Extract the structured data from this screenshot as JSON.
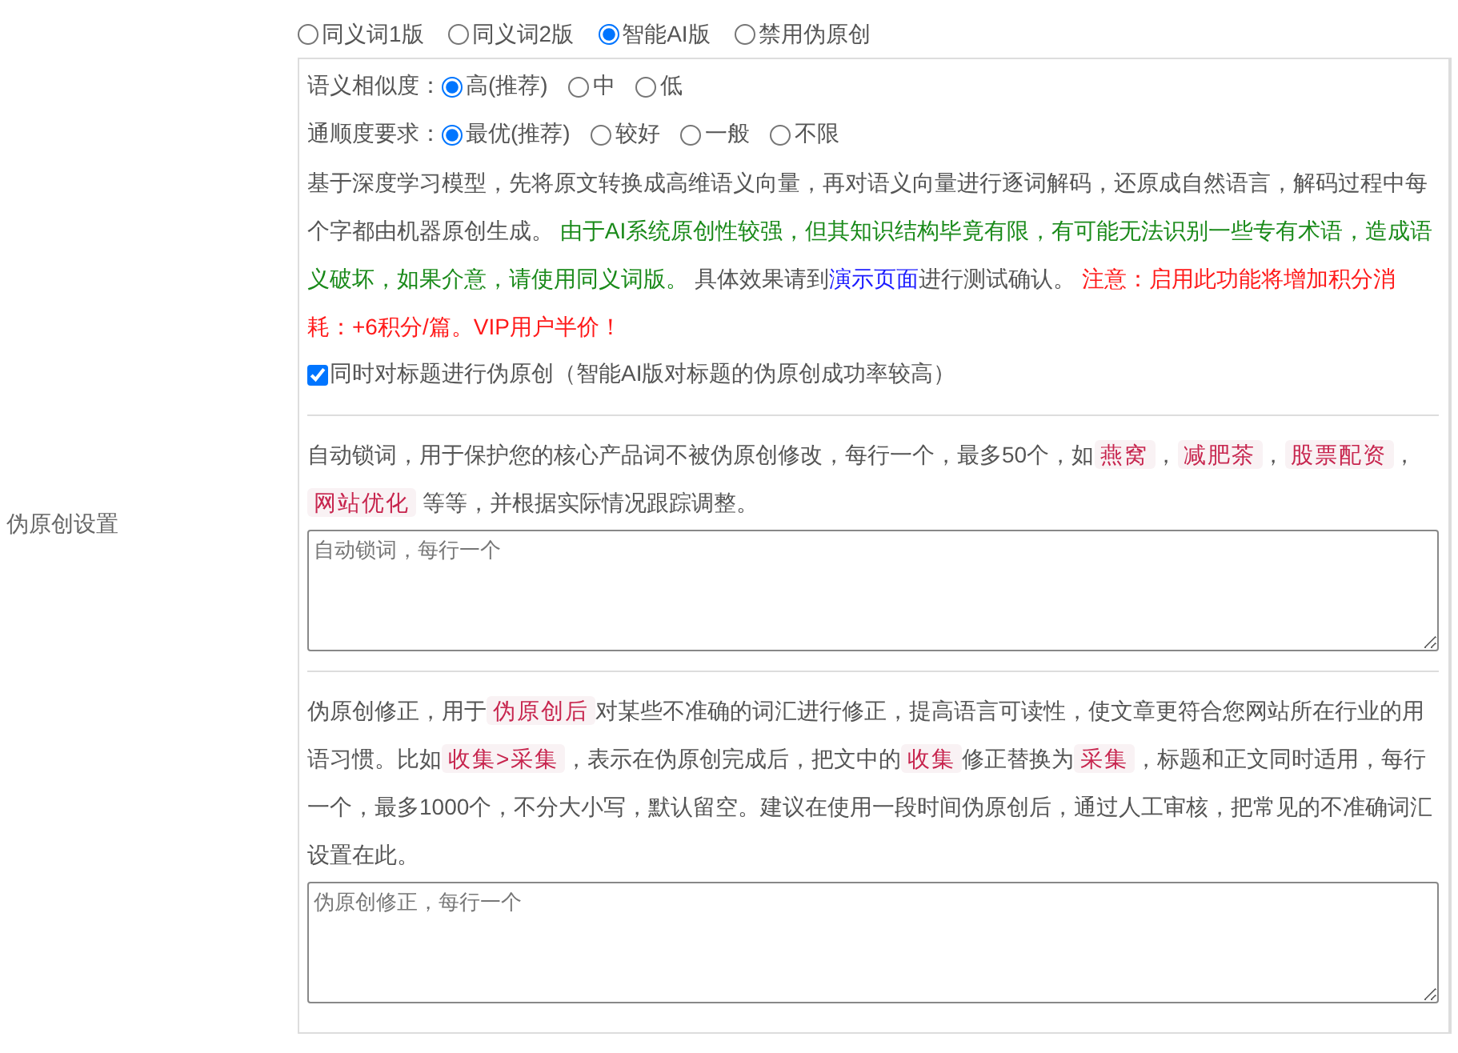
{
  "setting_label": "伪原创设置",
  "modes": [
    {
      "label": "同义词1版",
      "selected": false
    },
    {
      "label": "同义词2版",
      "selected": false
    },
    {
      "label": "智能AI版",
      "selected": true
    },
    {
      "label": "禁用伪原创",
      "selected": false
    }
  ],
  "option_rows": [
    {
      "label": "语义相似度：",
      "options": [
        {
          "label": "高(推荐)",
          "selected": true
        },
        {
          "label": "中",
          "selected": false
        },
        {
          "label": "低",
          "selected": false
        }
      ]
    },
    {
      "label": "通顺度要求：",
      "options": [
        {
          "label": "最优(推荐)",
          "selected": true
        },
        {
          "label": "较好",
          "selected": false
        },
        {
          "label": "一般",
          "selected": false
        },
        {
          "label": "不限",
          "selected": false
        }
      ]
    }
  ],
  "description": [
    {
      "kind": "plain",
      "text": "基于深度学习模型，先将原文转换成高维语义向量，再对语义向量进行逐词解码，还原成自然语言，解码过程中每个字都由机器原创生成。 "
    },
    {
      "kind": "green",
      "text": "由于AI系统原创性较强，但其知识结构毕竟有限，有可能无法识别一些专有术语，造成语义破坏，如果介意，请使用同义词版。"
    },
    {
      "kind": "plain",
      "text": " 具体效果请到"
    },
    {
      "kind": "link",
      "text": "演示页面"
    },
    {
      "kind": "plain",
      "text": "进行测试确认。 "
    },
    {
      "kind": "red",
      "text": "注意：启用此功能将增加积分消耗：+6积分/篇。VIP用户半价！"
    }
  ],
  "title_option": {
    "label": "同时对标题进行伪原创（智能AI版对标题的伪原创成功率较高）",
    "checked": true
  },
  "lock_words": {
    "description": [
      {
        "kind": "plain",
        "text": "自动锁词，用于保护您的核心产品词不被伪原创修改，每行一个，最多50个，如"
      },
      {
        "kind": "code",
        "text": "燕窝"
      },
      {
        "kind": "plain",
        "text": "，"
      },
      {
        "kind": "code",
        "text": "减肥茶"
      },
      {
        "kind": "plain",
        "text": "，"
      },
      {
        "kind": "code",
        "text": "股票配资"
      },
      {
        "kind": "plain",
        "text": "，"
      },
      {
        "kind": "code",
        "text": "网站优化"
      },
      {
        "kind": "plain",
        "text": " 等等，并根据实际情况跟踪调整。"
      }
    ],
    "placeholder": "自动锁词，每行一个"
  },
  "corrections": {
    "description": [
      {
        "kind": "plain",
        "text": "伪原创修正，用于"
      },
      {
        "kind": "code",
        "text": "伪原创后"
      },
      {
        "kind": "plain",
        "text": "对某些不准确的词汇进行修正，提高语言可读性，使文章更符合您网站所在行业的用语习惯。比如"
      },
      {
        "kind": "code",
        "text": "收集>采集"
      },
      {
        "kind": "plain",
        "text": "，表示在伪原创完成后，把文中的"
      },
      {
        "kind": "code",
        "text": "收集"
      },
      {
        "kind": "plain",
        "text": "修正替换为"
      },
      {
        "kind": "code",
        "text": "采集"
      },
      {
        "kind": "plain",
        "text": "，标题和正文同时适用，每行一个，最多1000个，不分大小写，默认留空。建议在使用一段时间伪原创后，通过人工审核，把常见的不准确词汇设置在此。"
      }
    ],
    "placeholder": "伪原创修正，每行一个"
  }
}
